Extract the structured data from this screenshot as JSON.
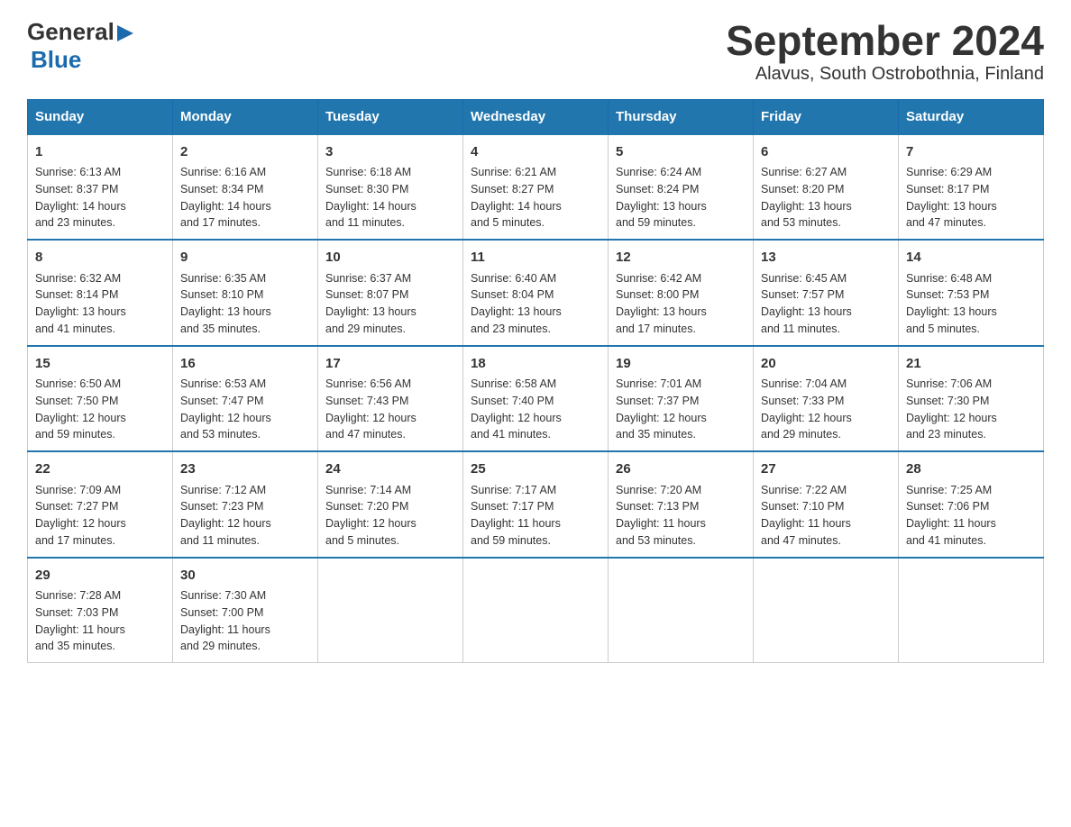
{
  "header": {
    "logo_general": "General",
    "logo_blue": "Blue",
    "title": "September 2024",
    "subtitle": "Alavus, South Ostrobothnia, Finland"
  },
  "days_of_week": [
    "Sunday",
    "Monday",
    "Tuesday",
    "Wednesday",
    "Thursday",
    "Friday",
    "Saturday"
  ],
  "weeks": [
    [
      {
        "day": "1",
        "sunrise": "6:13 AM",
        "sunset": "8:37 PM",
        "daylight": "14 hours and 23 minutes."
      },
      {
        "day": "2",
        "sunrise": "6:16 AM",
        "sunset": "8:34 PM",
        "daylight": "14 hours and 17 minutes."
      },
      {
        "day": "3",
        "sunrise": "6:18 AM",
        "sunset": "8:30 PM",
        "daylight": "14 hours and 11 minutes."
      },
      {
        "day": "4",
        "sunrise": "6:21 AM",
        "sunset": "8:27 PM",
        "daylight": "14 hours and 5 minutes."
      },
      {
        "day": "5",
        "sunrise": "6:24 AM",
        "sunset": "8:24 PM",
        "daylight": "13 hours and 59 minutes."
      },
      {
        "day": "6",
        "sunrise": "6:27 AM",
        "sunset": "8:20 PM",
        "daylight": "13 hours and 53 minutes."
      },
      {
        "day": "7",
        "sunrise": "6:29 AM",
        "sunset": "8:17 PM",
        "daylight": "13 hours and 47 minutes."
      }
    ],
    [
      {
        "day": "8",
        "sunrise": "6:32 AM",
        "sunset": "8:14 PM",
        "daylight": "13 hours and 41 minutes."
      },
      {
        "day": "9",
        "sunrise": "6:35 AM",
        "sunset": "8:10 PM",
        "daylight": "13 hours and 35 minutes."
      },
      {
        "day": "10",
        "sunrise": "6:37 AM",
        "sunset": "8:07 PM",
        "daylight": "13 hours and 29 minutes."
      },
      {
        "day": "11",
        "sunrise": "6:40 AM",
        "sunset": "8:04 PM",
        "daylight": "13 hours and 23 minutes."
      },
      {
        "day": "12",
        "sunrise": "6:42 AM",
        "sunset": "8:00 PM",
        "daylight": "13 hours and 17 minutes."
      },
      {
        "day": "13",
        "sunrise": "6:45 AM",
        "sunset": "7:57 PM",
        "daylight": "13 hours and 11 minutes."
      },
      {
        "day": "14",
        "sunrise": "6:48 AM",
        "sunset": "7:53 PM",
        "daylight": "13 hours and 5 minutes."
      }
    ],
    [
      {
        "day": "15",
        "sunrise": "6:50 AM",
        "sunset": "7:50 PM",
        "daylight": "12 hours and 59 minutes."
      },
      {
        "day": "16",
        "sunrise": "6:53 AM",
        "sunset": "7:47 PM",
        "daylight": "12 hours and 53 minutes."
      },
      {
        "day": "17",
        "sunrise": "6:56 AM",
        "sunset": "7:43 PM",
        "daylight": "12 hours and 47 minutes."
      },
      {
        "day": "18",
        "sunrise": "6:58 AM",
        "sunset": "7:40 PM",
        "daylight": "12 hours and 41 minutes."
      },
      {
        "day": "19",
        "sunrise": "7:01 AM",
        "sunset": "7:37 PM",
        "daylight": "12 hours and 35 minutes."
      },
      {
        "day": "20",
        "sunrise": "7:04 AM",
        "sunset": "7:33 PM",
        "daylight": "12 hours and 29 minutes."
      },
      {
        "day": "21",
        "sunrise": "7:06 AM",
        "sunset": "7:30 PM",
        "daylight": "12 hours and 23 minutes."
      }
    ],
    [
      {
        "day": "22",
        "sunrise": "7:09 AM",
        "sunset": "7:27 PM",
        "daylight": "12 hours and 17 minutes."
      },
      {
        "day": "23",
        "sunrise": "7:12 AM",
        "sunset": "7:23 PM",
        "daylight": "12 hours and 11 minutes."
      },
      {
        "day": "24",
        "sunrise": "7:14 AM",
        "sunset": "7:20 PM",
        "daylight": "12 hours and 5 minutes."
      },
      {
        "day": "25",
        "sunrise": "7:17 AM",
        "sunset": "7:17 PM",
        "daylight": "11 hours and 59 minutes."
      },
      {
        "day": "26",
        "sunrise": "7:20 AM",
        "sunset": "7:13 PM",
        "daylight": "11 hours and 53 minutes."
      },
      {
        "day": "27",
        "sunrise": "7:22 AM",
        "sunset": "7:10 PM",
        "daylight": "11 hours and 47 minutes."
      },
      {
        "day": "28",
        "sunrise": "7:25 AM",
        "sunset": "7:06 PM",
        "daylight": "11 hours and 41 minutes."
      }
    ],
    [
      {
        "day": "29",
        "sunrise": "7:28 AM",
        "sunset": "7:03 PM",
        "daylight": "11 hours and 35 minutes."
      },
      {
        "day": "30",
        "sunrise": "7:30 AM",
        "sunset": "7:00 PM",
        "daylight": "11 hours and 29 minutes."
      },
      null,
      null,
      null,
      null,
      null
    ]
  ],
  "labels": {
    "sunrise": "Sunrise:",
    "sunset": "Sunset:",
    "daylight": "Daylight:"
  }
}
